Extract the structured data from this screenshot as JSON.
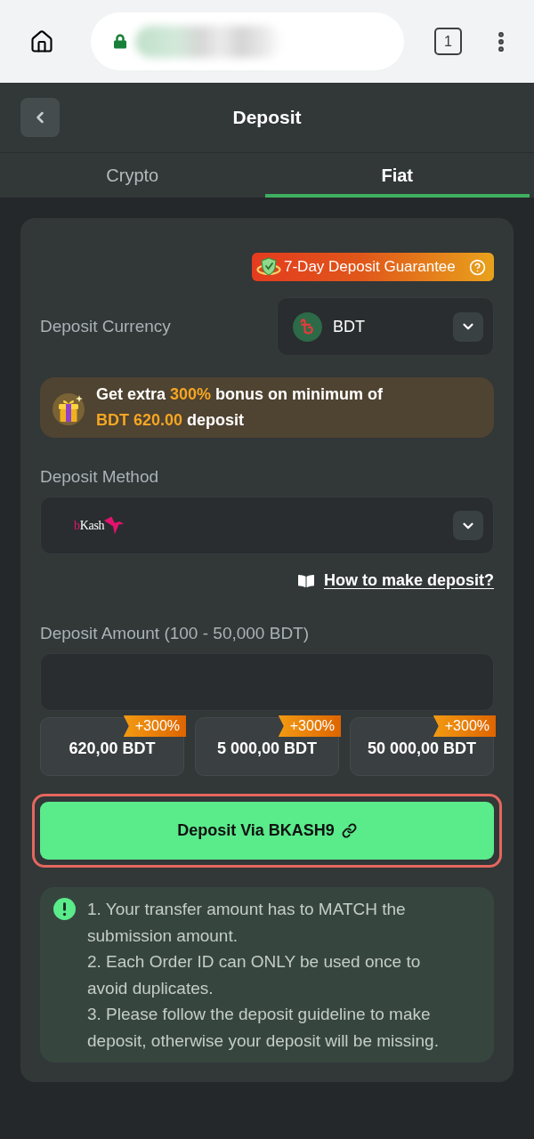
{
  "browser": {
    "tab_count": "1"
  },
  "header": {
    "title": "Deposit"
  },
  "tabs": [
    {
      "label": "Crypto",
      "selected": false
    },
    {
      "label": "Fiat",
      "selected": true
    }
  ],
  "guarantee_badge": {
    "label": "7-Day Deposit Guarantee"
  },
  "currency": {
    "label": "Deposit Currency",
    "value": "BDT"
  },
  "bonus_banner": {
    "segments": [
      {
        "text": "Get extra ",
        "highlight": false
      },
      {
        "text": "300%",
        "highlight": true
      },
      {
        "text": " bonus on minimum of ",
        "highlight": false
      },
      {
        "text": "BDT 620.00",
        "highlight": true
      },
      {
        "text": " deposit",
        "highlight": false
      }
    ]
  },
  "method": {
    "label": "Deposit Method",
    "logo_text": "bKash"
  },
  "guide_link": {
    "label": "How to make deposit?"
  },
  "amount": {
    "label": "Deposit Amount (100 - 50,000 BDT)"
  },
  "quick_amounts": [
    {
      "amount": "620,00 BDT",
      "tag": "+300%"
    },
    {
      "amount": "5 000,00 BDT",
      "tag": "+300%"
    },
    {
      "amount": "50 000,00 BDT",
      "tag": "+300%"
    }
  ],
  "submit": {
    "label": "Deposit Via BKASH9",
    "highlighted": true
  },
  "notice": {
    "items": [
      "1. Your transfer amount has to MATCH the submission amount.",
      "2. Each Order ID can ONLY be used once to avoid duplicates.",
      "3. Please follow the deposit guideline to make deposit, otherwise your deposit will be missing."
    ]
  }
}
